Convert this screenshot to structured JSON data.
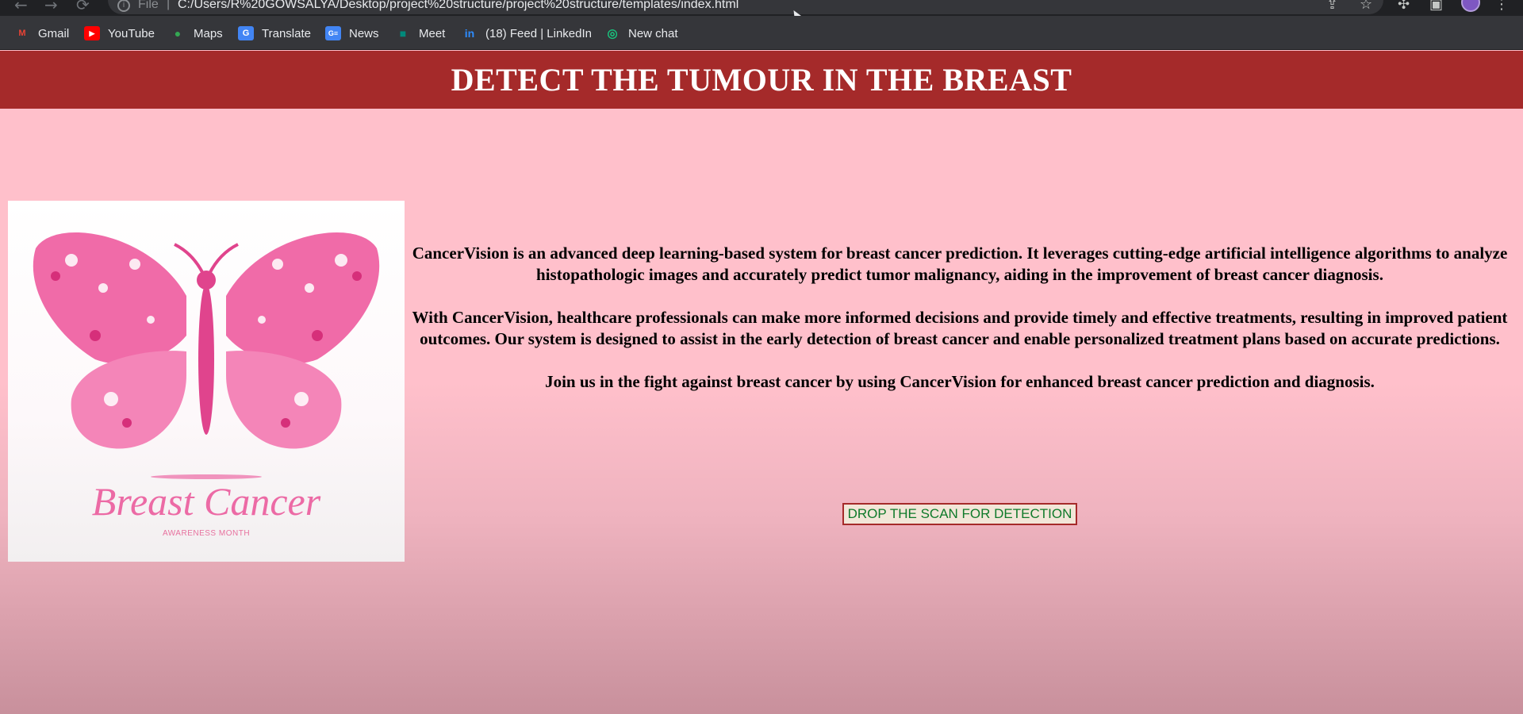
{
  "browser": {
    "nav": {
      "back_icon": "←",
      "forward_icon": "→",
      "reload_icon": "⟳"
    },
    "omnibox": {
      "info_icon": "i",
      "scheme_label": "File",
      "separator": "|",
      "url": "C:/Users/R%20GOWSALYA/Desktop/project%20structure/project%20structure/templates/index.html"
    },
    "toolbar_icons": {
      "share": "⇪",
      "star": "☆",
      "extensions": "✣",
      "sidebar": "▣",
      "menu": "⋮"
    },
    "bookmarks": [
      {
        "label": "Gmail",
        "icon": "M",
        "color": "#ea4335"
      },
      {
        "label": "YouTube",
        "icon": "▶",
        "color": "#ff0000"
      },
      {
        "label": "Maps",
        "icon": "●",
        "color": "#34a853"
      },
      {
        "label": "Translate",
        "icon": "G",
        "color": "#4285f4"
      },
      {
        "label": "News",
        "icon": "G≡",
        "color": "#4285f4"
      },
      {
        "label": "Meet",
        "icon": "■",
        "color": "#00897b"
      },
      {
        "label": "(18) Feed | LinkedIn",
        "icon": "in",
        "color": "#0a66c2"
      },
      {
        "label": "New chat",
        "icon": "◎",
        "color": "#10a37f"
      }
    ]
  },
  "page": {
    "header_title": "DETECT THE TUMOUR IN THE BREAST",
    "poster": {
      "title": "Breast Cancer",
      "subtitle": "AWARENESS MONTH"
    },
    "paragraphs": [
      "CancerVision is an advanced deep learning-based system for breast cancer prediction. It leverages cutting-edge artificial intelligence algorithms to analyze histopathologic images and accurately predict tumor malignancy, aiding in the improvement of breast cancer diagnosis.",
      "With CancerVision, healthcare professionals can make more informed decisions and provide timely and effective treatments, resulting in improved patient outcomes. Our system is designed to assist in the early detection of breast cancer and enable personalized treatment plans based on accurate predictions.",
      "Join us in the fight against breast cancer by using CancerVision for enhanced breast cancer prediction and diagnosis."
    ],
    "drop_button_label": "DROP THE SCAN FOR DETECTION"
  },
  "colors": {
    "header_bg": "#a52a2a",
    "page_bg": "#ffc0cb",
    "button_text": "#0f7a2a",
    "button_border": "#a52a2a"
  }
}
